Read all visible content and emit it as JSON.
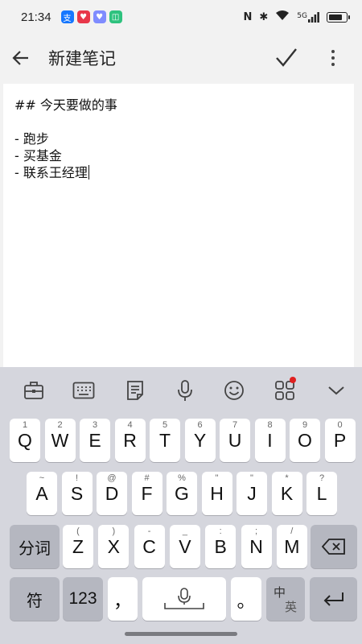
{
  "status_bar": {
    "time": "21:34",
    "app_icons": [
      {
        "name": "alipay-icon",
        "glyph": "支",
        "color": "#1677ff"
      },
      {
        "name": "heart-app-icon",
        "glyph": "♥",
        "color": "#e8374a"
      },
      {
        "name": "heart-chat-icon",
        "glyph": "♥",
        "color": "#7f8cff"
      },
      {
        "name": "mi-app-icon",
        "glyph": "◫",
        "color": "#2ec27e"
      }
    ],
    "nfc": "N",
    "bluetooth": "✱",
    "signal": "5G",
    "battery_level": 0.85
  },
  "app_bar": {
    "title": "新建笔记"
  },
  "editor": {
    "lines": [
      "## 今天要做的事",
      "",
      "- 跑步",
      "- 买基金",
      "- 联系王经理"
    ]
  },
  "keyboard": {
    "toolbar": [
      {
        "name": "toolbox-icon"
      },
      {
        "name": "keyboard-icon"
      },
      {
        "name": "clipboard-icon"
      },
      {
        "name": "microphone-icon"
      },
      {
        "name": "emoji-icon"
      },
      {
        "name": "apps-grid-icon"
      },
      {
        "name": "collapse-icon"
      }
    ],
    "row1": [
      {
        "key": "Q",
        "hint": "1"
      },
      {
        "key": "W",
        "hint": "2"
      },
      {
        "key": "E",
        "hint": "3"
      },
      {
        "key": "R",
        "hint": "4"
      },
      {
        "key": "T",
        "hint": "5"
      },
      {
        "key": "Y",
        "hint": "6"
      },
      {
        "key": "U",
        "hint": "7"
      },
      {
        "key": "I",
        "hint": "8"
      },
      {
        "key": "O",
        "hint": "9"
      },
      {
        "key": "P",
        "hint": "0"
      }
    ],
    "row2": [
      {
        "key": "A",
        "hint": "~"
      },
      {
        "key": "S",
        "hint": "!"
      },
      {
        "key": "D",
        "hint": "@"
      },
      {
        "key": "F",
        "hint": "#"
      },
      {
        "key": "G",
        "hint": "%"
      },
      {
        "key": "H",
        "hint": "\""
      },
      {
        "key": "J",
        "hint": "\""
      },
      {
        "key": "K",
        "hint": "*"
      },
      {
        "key": "L",
        "hint": "?"
      }
    ],
    "row3": [
      {
        "key": "Z",
        "hint": "("
      },
      {
        "key": "X",
        "hint": ")"
      },
      {
        "key": "C",
        "hint": "-"
      },
      {
        "key": "V",
        "hint": "_"
      },
      {
        "key": "B",
        "hint": ":"
      },
      {
        "key": "N",
        "hint": ";"
      },
      {
        "key": "M",
        "hint": "/"
      }
    ],
    "fenci": "分词",
    "symbol": "符",
    "numbers": "123",
    "comma": "，",
    "period": "。",
    "lang_top": "中",
    "lang_bottom": "英"
  }
}
